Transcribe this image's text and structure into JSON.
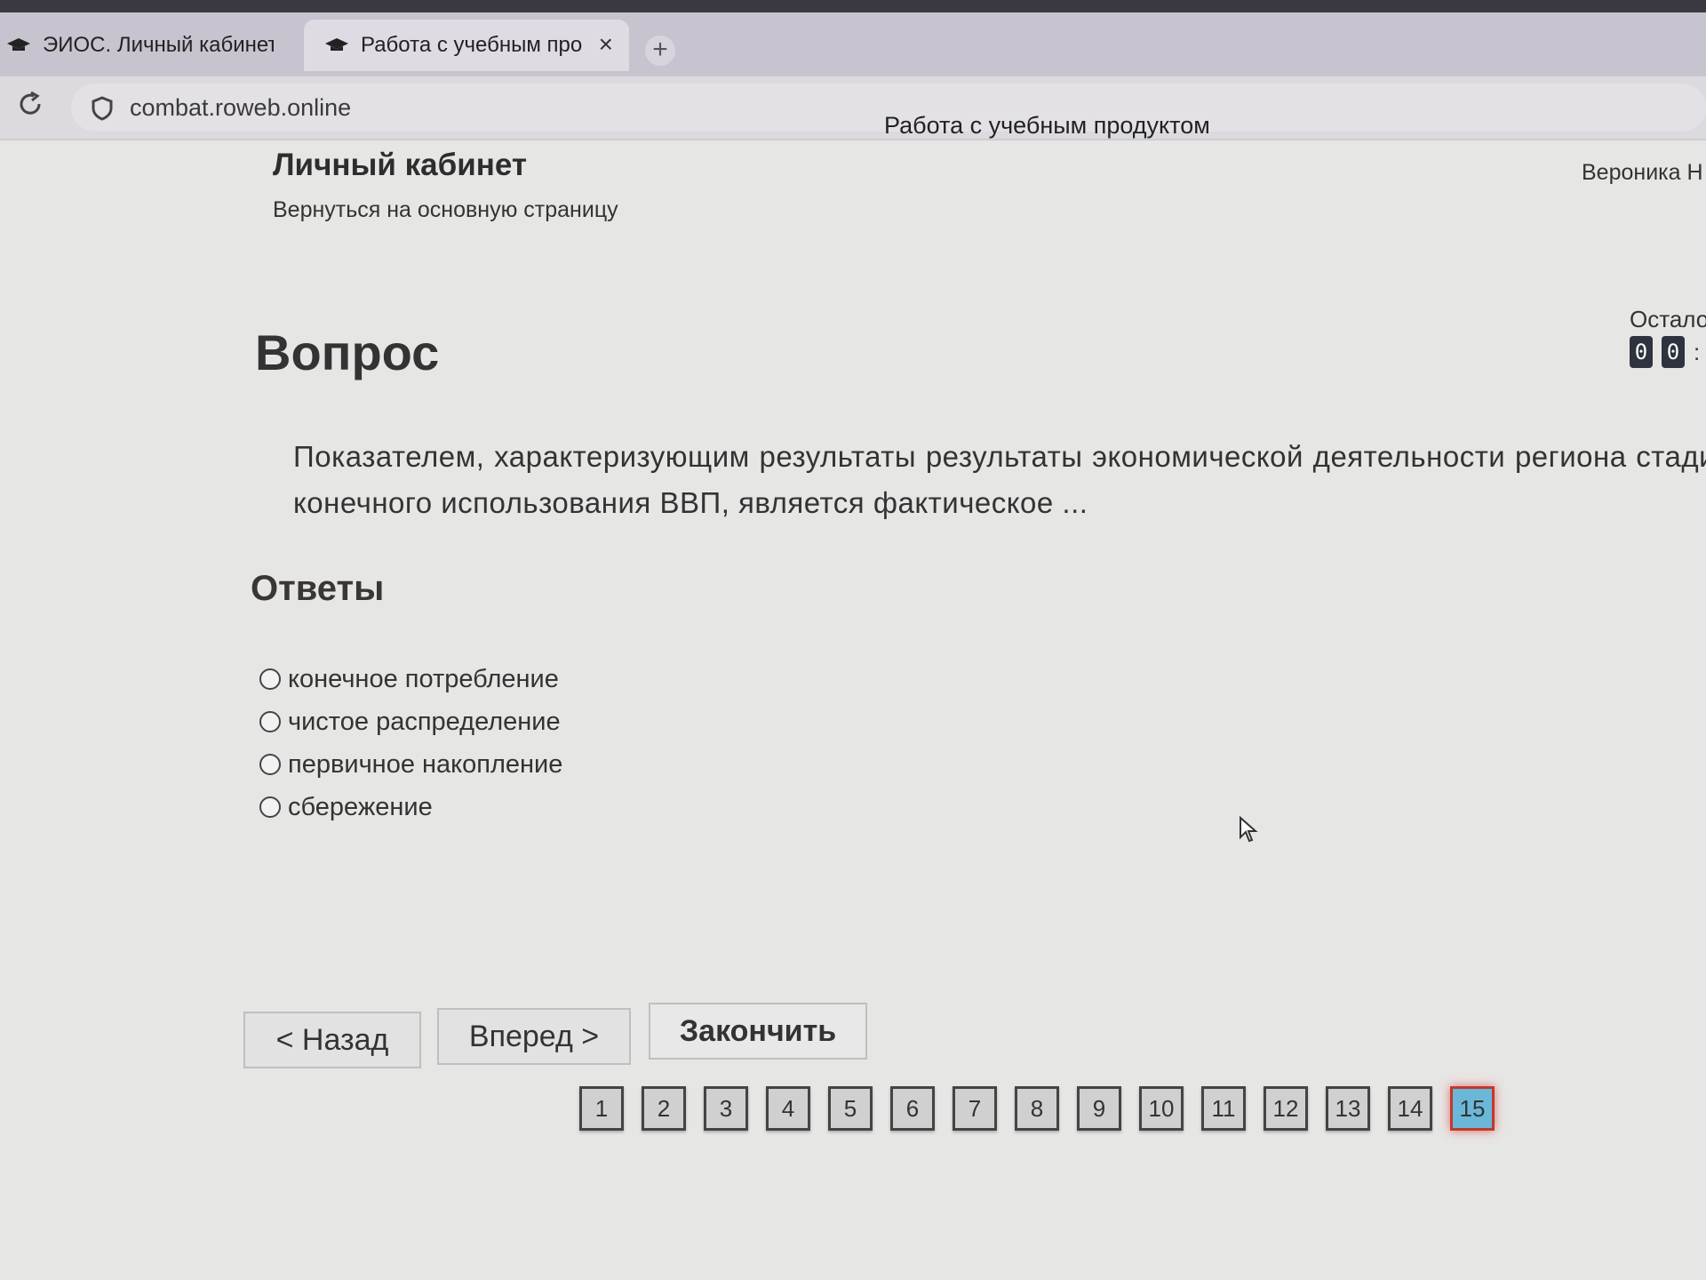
{
  "browser": {
    "tabs": [
      {
        "label": "ЭИОС. Личный кабинет",
        "active": false
      },
      {
        "label": "Работа с учебным про",
        "active": true
      }
    ],
    "new_tab_label": "+",
    "close_icon": "×",
    "url": "combat.roweb.online",
    "page_title": "Работа с учебным продуктом"
  },
  "header": {
    "title": "Личный кабинет",
    "back_link": "Вернуться на основную страницу",
    "user": "Вероника Н"
  },
  "timer": {
    "label": "Остало",
    "digits": [
      "0",
      "0"
    ],
    "separator": ":"
  },
  "question": {
    "heading": "Вопрос",
    "text": "Показателем, характеризующим результаты результаты экономической деятельности региона стадии конечного использования ВВП, является фактическое ..."
  },
  "answers": {
    "heading": "Ответы",
    "options": [
      "конечное потребление",
      "чистое распределение",
      "первичное накопление",
      "сбережение"
    ]
  },
  "navigation": {
    "back_label": "< Назад",
    "next_label": "Вперед >",
    "finish_label": "Закончить"
  },
  "pager": {
    "pages": [
      "1",
      "2",
      "3",
      "4",
      "5",
      "6",
      "7",
      "8",
      "9",
      "10",
      "11",
      "12",
      "13",
      "14",
      "15"
    ],
    "current": "15"
  },
  "colors": {
    "current_page_fill": "#6bb7d8",
    "current_page_border": "#c0392b",
    "timer_digit_bg": "#2f3340"
  }
}
